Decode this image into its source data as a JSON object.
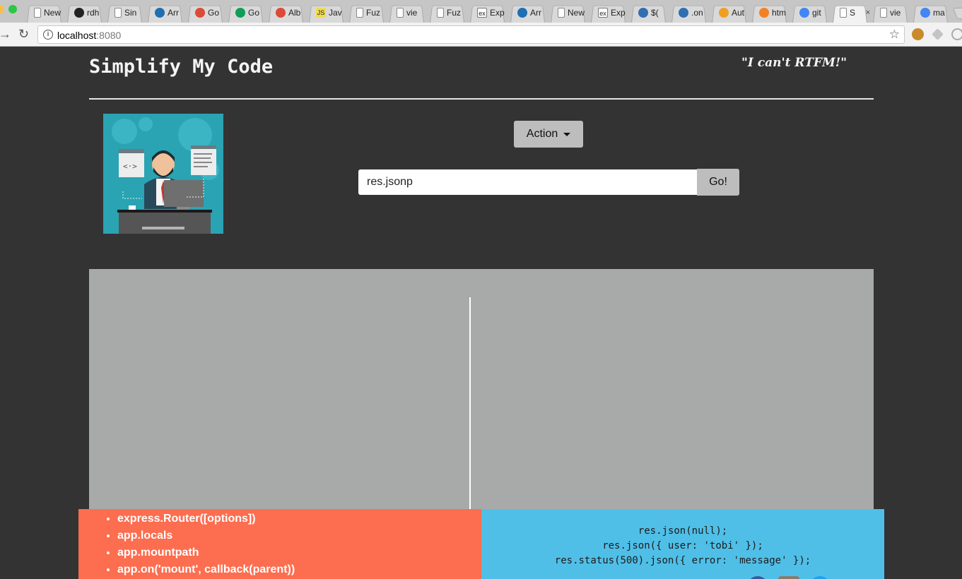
{
  "browser": {
    "tabs": [
      {
        "title": "New Ta",
        "icon": "blank",
        "color": "#9a9a9a",
        "active": false
      },
      {
        "title": "rdh",
        "icon": "github-icon",
        "color": "#222222",
        "active": false
      },
      {
        "title": "Sin",
        "icon": "page-icon",
        "color": "#9a9a9a",
        "active": false
      },
      {
        "title": "Arr",
        "icon": "mdn-icon",
        "color": "#1f6fb2",
        "active": false
      },
      {
        "title": "Go",
        "icon": "google-plus-icon",
        "color": "#dc4a38",
        "active": false
      },
      {
        "title": "Go",
        "icon": "hangouts-icon",
        "color": "#0f9d58",
        "active": false
      },
      {
        "title": "Alb",
        "icon": "google-plus-icon",
        "color": "#dc4a38",
        "active": false
      },
      {
        "title": "Jav",
        "icon": "js-icon",
        "color": "#f0db4f",
        "active": false
      },
      {
        "title": "Fuz",
        "icon": "page-icon",
        "color": "#9a9a9a",
        "active": false
      },
      {
        "title": "vie",
        "icon": "page-icon",
        "color": "#9a9a9a",
        "active": false
      },
      {
        "title": "Fuz",
        "icon": "page-icon",
        "color": "#9a9a9a",
        "active": false
      },
      {
        "title": "Exp",
        "icon": "express-icon",
        "color": "#ffffff",
        "active": false
      },
      {
        "title": "Arr",
        "icon": "mdn-icon",
        "color": "#1f6fb2",
        "active": false
      },
      {
        "title": "New Ta",
        "icon": "blank",
        "color": "#9a9a9a",
        "active": false
      },
      {
        "title": "Exp",
        "icon": "express-icon",
        "color": "#ffffff",
        "active": false
      },
      {
        "title": "$(",
        "icon": "jquery-icon",
        "color": "#2f6fb2",
        "active": false
      },
      {
        "title": ".on",
        "icon": "jquery-icon",
        "color": "#2f6fb2",
        "active": false
      },
      {
        "title": "Aut",
        "icon": "uservoice-icon",
        "color": "#f0a020",
        "active": false
      },
      {
        "title": "htm",
        "icon": "stackoverflow-icon",
        "color": "#f48024",
        "active": false
      },
      {
        "title": "git",
        "icon": "google-icon",
        "color": "#4285f4",
        "active": false
      },
      {
        "title": "S",
        "icon": "page-icon",
        "color": "#9a9a9a",
        "active": true
      },
      {
        "title": "vie",
        "icon": "page-icon",
        "color": "#9a9a9a",
        "active": false
      },
      {
        "title": "ma",
        "icon": "google-icon",
        "color": "#4285f4",
        "active": false
      }
    ],
    "url_host": "localhost",
    "url_port": ":8080"
  },
  "header": {
    "title": "Simplify My Code",
    "tagline": "\"I can't RTFM!\""
  },
  "controls": {
    "action_label": "Action",
    "search_value": "res.jsonp",
    "go_label": "Go!"
  },
  "methods": {
    "items": [
      "express.Router([options])",
      "app.locals",
      "app.mountpath",
      "app.on('mount', callback(parent))"
    ]
  },
  "example": {
    "code": "res.json(null);\nres.json({ user: 'tobi' });\nres.status(500).json({ error: 'message' });"
  },
  "colors": {
    "background": "#333333",
    "results_bg": "#a8aaa9",
    "methods_bg": "#fd6d4f",
    "example_bg": "#4fbfe8",
    "button_bg": "#bdbdbd"
  }
}
